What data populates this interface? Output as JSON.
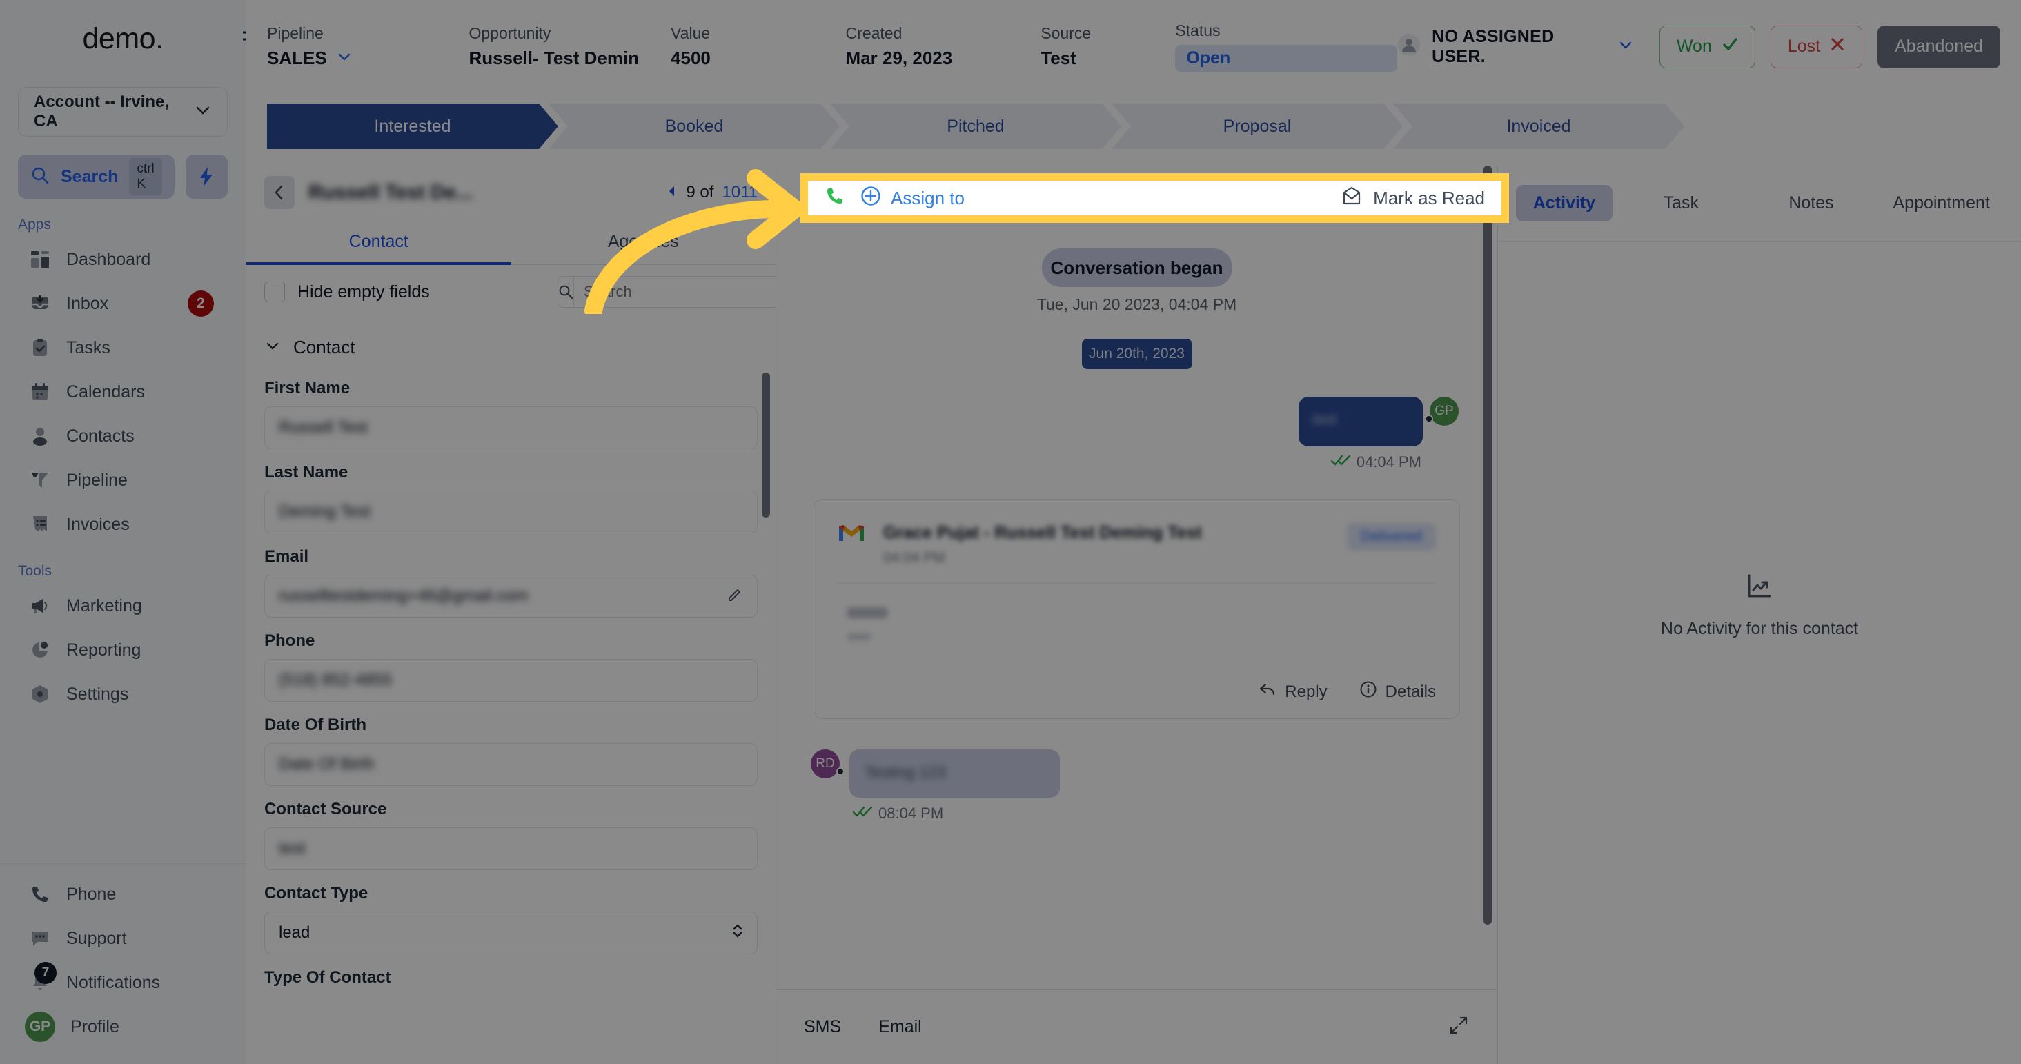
{
  "sidebar": {
    "brand": "demo",
    "account_selector": {
      "label": "Account -- Irvine, CA",
      "chevron_icon": "chevron-down-icon"
    },
    "search": {
      "label": "Search",
      "shortcut": "ctrl K",
      "icon": "search-icon"
    },
    "bolt_icon": "lightning-bolt-icon",
    "groups": [
      {
        "label": "Apps",
        "items": [
          {
            "label": "Dashboard",
            "icon": "dashboard-icon",
            "badge": ""
          },
          {
            "label": "Inbox",
            "icon": "inbox-icon",
            "badge": "2"
          },
          {
            "label": "Tasks",
            "icon": "tasks-clipboard-icon",
            "badge": ""
          },
          {
            "label": "Calendars",
            "icon": "calendar-icon",
            "badge": ""
          },
          {
            "label": "Contacts",
            "icon": "contacts-person-icon",
            "badge": ""
          },
          {
            "label": "Pipeline",
            "icon": "pipeline-funnel-icon",
            "badge": ""
          },
          {
            "label": "Invoices",
            "icon": "invoice-receipt-icon",
            "badge": ""
          }
        ]
      },
      {
        "label": "Tools",
        "items": [
          {
            "label": "Marketing",
            "icon": "megaphone-icon",
            "badge": ""
          },
          {
            "label": "Reporting",
            "icon": "pie-chart-icon",
            "badge": ""
          },
          {
            "label": "Settings",
            "icon": "gear-icon",
            "badge": ""
          }
        ]
      }
    ],
    "footer_items": [
      {
        "label": "Phone",
        "icon": "phone-icon",
        "badge": ""
      },
      {
        "label": "Support",
        "icon": "chat-support-icon",
        "badge": ""
      },
      {
        "label": "Notifications",
        "icon": "bell-icon",
        "badge": "7"
      },
      {
        "label": "Profile",
        "icon": "avatar-icon",
        "badge": "",
        "initials": "GP"
      }
    ]
  },
  "header": {
    "pipeline": {
      "label": "Pipeline",
      "value": "SALES"
    },
    "opportunity": {
      "label": "Opportunity",
      "value": "Russell- Test Demin"
    },
    "value": {
      "label": "Value",
      "value": "4500"
    },
    "created": {
      "label": "Created",
      "value": "Mar 29, 2023"
    },
    "source": {
      "label": "Source",
      "value": "Test"
    },
    "status": {
      "label": "Status",
      "value": "Open"
    },
    "assigned_user": "NO ASSIGNED USER.",
    "buttons": {
      "won": "Won",
      "lost": "Lost",
      "abandoned": "Abandoned"
    }
  },
  "stages": [
    {
      "label": "Interested",
      "active": true
    },
    {
      "label": "Booked",
      "active": false
    },
    {
      "label": "Pitched",
      "active": false
    },
    {
      "label": "Proposal",
      "active": false
    },
    {
      "label": "Invoiced",
      "active": false
    }
  ],
  "contact_panel": {
    "title": "Russell Test De...",
    "pager": {
      "current": "9 of",
      "total": "1011"
    },
    "tabs": [
      {
        "label": "Contact",
        "active": true
      },
      {
        "label": "Agencies",
        "active": false
      }
    ],
    "hide_empty_fields": "Hide empty fields",
    "search_placeholder": "Search",
    "section_title": "Contact",
    "fields": [
      {
        "label": "First Name",
        "value": "Russell Test",
        "blurred": true,
        "type": "text"
      },
      {
        "label": "Last Name",
        "value": "Deming Test",
        "blurred": true,
        "type": "text"
      },
      {
        "label": "Email",
        "value": "russelltestdeming+46@gmail.com",
        "blurred": true,
        "type": "text",
        "edit_icon": "pencil-icon"
      },
      {
        "label": "Phone",
        "value": "(518) 852-4855",
        "blurred": true,
        "type": "text"
      },
      {
        "label": "Date Of Birth",
        "value": "Date Of Birth",
        "blurred": true,
        "type": "text"
      },
      {
        "label": "Contact Source",
        "value": "test",
        "blurred": true,
        "type": "text"
      },
      {
        "label": "Contact Type",
        "value": "lead",
        "blurred": false,
        "type": "select"
      },
      {
        "label": "Type Of Contact",
        "value": "",
        "blurred": false,
        "type": "text"
      }
    ]
  },
  "highlight_banner": {
    "phone_icon": "phone-icon",
    "assign_icon": "plus-circle-icon",
    "assign_label": "Assign to",
    "mark_read_icon": "envelope-open-icon",
    "mark_read_label": "Mark as Read",
    "border_color": "#ffce45"
  },
  "conversation": {
    "began_chip": "Conversation began",
    "began_subtitle": "Tue, Jun 20 2023, 04:04 PM",
    "date_chip": "Jun 20th, 2023",
    "outgoing_message": {
      "text": "test",
      "time": "04:04 PM",
      "avatar": "GP",
      "blurred": true
    },
    "email_card": {
      "provider_icon": "gmail-icon",
      "subject": "Grace Pujat - Russell Test Deming Test",
      "time": "04:04 PM",
      "tag": "Delivered",
      "body": "test",
      "reply_label": "Reply",
      "reply_icon": "reply-arrow-icon",
      "details_label": "Details",
      "details_icon": "info-circle-icon",
      "blurred": true
    },
    "incoming_message": {
      "text": "Testing 123",
      "time": "08:04 PM",
      "avatar": "RD",
      "blurred": true
    },
    "footer_tabs": [
      "SMS",
      "Email"
    ],
    "expand_icon": "expand-diagonal-icon"
  },
  "activity_panel": {
    "tabs": [
      {
        "label": "Activity",
        "active": true
      },
      {
        "label": "Task",
        "active": false
      },
      {
        "label": "Notes",
        "active": false
      },
      {
        "label": "Appointment",
        "active": false
      }
    ],
    "empty_icon": "chart-line-icon",
    "empty_text": "No Activity for this contact"
  },
  "annotation": {
    "arrow_color": "#ffce45",
    "arrow_icon": "curved-arrow-right-icon"
  }
}
